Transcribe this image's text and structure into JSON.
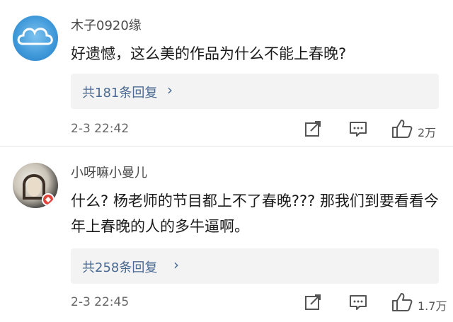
{
  "comments": [
    {
      "username": "木子0920缘",
      "text": "好遗憾，这么美的作品为什么不能上春晚?",
      "replies_label": "共181条回复",
      "time": "2-3 22:42",
      "likes": "2万"
    },
    {
      "username": "小呀嘛小曼儿",
      "text": "什么? 杨老师的节目都上不了春晚??? 那我们到要看看今年上春晚的人的多牛逼啊。",
      "replies_label": "共258条回复",
      "time": "2-3 22:45",
      "likes": "1.7万"
    }
  ],
  "icons": {
    "chevron": "chevron-right-icon",
    "share": "share-icon",
    "comment": "comment-icon",
    "like": "thumbs-up-icon"
  },
  "colors": {
    "link": "#4a6a93",
    "reply_box": "#f3f3f3"
  }
}
